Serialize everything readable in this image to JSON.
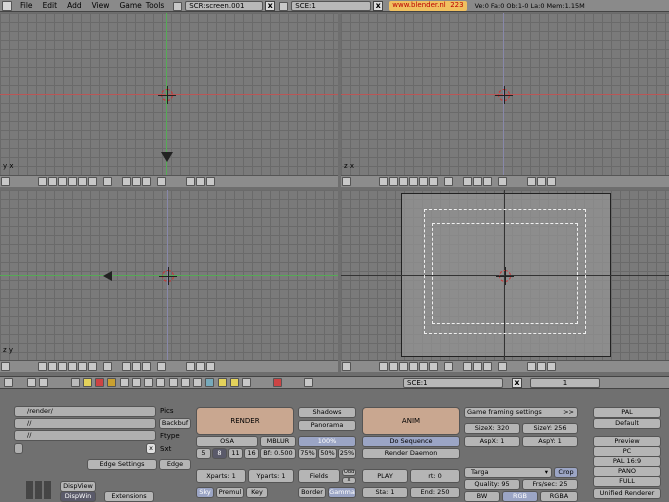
{
  "menubar": {
    "items": [
      "File",
      "Edit",
      "Add",
      "View",
      "Game",
      "Tools"
    ],
    "screen": "SCR:screen.001",
    "scene": "SCE:1",
    "url": "www.blender.nl",
    "version": "223",
    "stats": "Ve:0 Fa:0  Ob:1-0  La:0  Mem:1.15M"
  },
  "viewports": {
    "top_left_axis": "y x",
    "bottom_left_axis": "z y",
    "top_right_axis": "z x"
  },
  "buttons_header": {
    "scene": "SCE:1",
    "frame": "1"
  },
  "render": {
    "paths": {
      "pics": "/render/",
      "backbuf": "//",
      "ftype": "//"
    },
    "labels": {
      "pics": "Pics",
      "backbuf": "Backbuf",
      "ftype": "Ftype",
      "sxt": "Sxt",
      "edge_settings": "Edge Settings",
      "edge": "Edge",
      "dispview": "DispView",
      "dispwin": "DispWin",
      "extensions": "Extensions"
    },
    "render_btn": "RENDER",
    "shadows": "Shadows",
    "panorama": "Panorama",
    "anim_btn": "ANIM",
    "osa": "OSA",
    "mblur": "MBLUR",
    "percent100": "100%",
    "osa_vals": [
      "5",
      "8",
      "11",
      "16"
    ],
    "bf": "Bf: 0.500",
    "pct": [
      "75%",
      "50%",
      "25%"
    ],
    "do_sequence": "Do Sequence",
    "render_daemon": "Render Daemon",
    "xparts": "Xparts: 1",
    "yparts": "Yparts: 1",
    "fields": "Fields",
    "odd": "Odd",
    "x": "x",
    "play": "PLAY",
    "rt": "rt: 0",
    "sky": "Sky",
    "premul": "Premul",
    "key": "Key",
    "border": "Border",
    "gamma": "Gamma",
    "sta": "Sta: 1",
    "end": "End: 250",
    "framing": "Game framing settings",
    "sizex": "SizeX: 320",
    "sizey": "SizeY: 256",
    "aspx": "AspX: 1",
    "aspy": "AspY: 1",
    "format": "Targa",
    "crop": "Crop",
    "quality": "Quality: 95",
    "frs": "Frs/sec: 25",
    "bw": "BW",
    "rgb": "RGB",
    "rgba": "RGBA",
    "presets": [
      "PAL",
      "Default",
      "Preview",
      "PC",
      "PAL 16:9",
      "PANO",
      "FULL",
      "Unified Renderer"
    ]
  }
}
